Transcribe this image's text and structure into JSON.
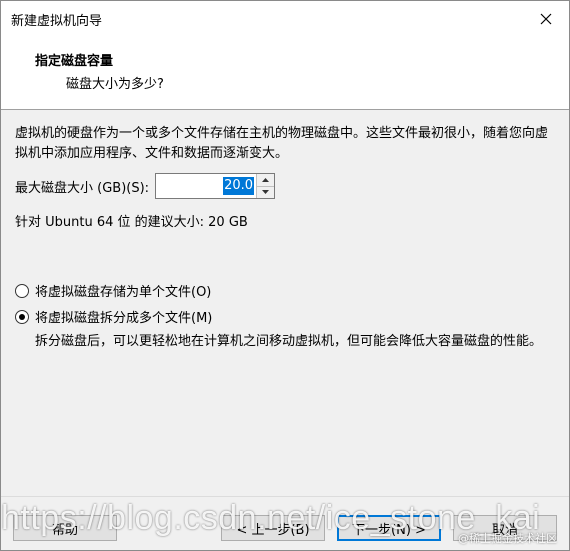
{
  "window": {
    "title": "新建虚拟机向导"
  },
  "header": {
    "title": "指定磁盘容量",
    "subtitle": "磁盘大小为多少?"
  },
  "body": {
    "description": "虚拟机的硬盘作为一个或多个文件存储在主机的物理磁盘中。这些文件最初很小，随着您向虚拟机中添加应用程序、文件和数据而逐渐变大。",
    "max_size_label": "最大磁盘大小 (GB)(S):",
    "max_size_value": "20.0",
    "recommended": "针对 Ubuntu 64 位 的建议大小: 20 GB",
    "options": [
      {
        "label": "将虚拟磁盘存储为单个文件(O)",
        "checked": false
      },
      {
        "label": "将虚拟磁盘拆分成多个文件(M)",
        "checked": true
      }
    ],
    "split_description": "拆分磁盘后，可以更轻松地在计算机之间移动虚拟机，但可能会降低大容量磁盘的性能。"
  },
  "footer": {
    "help": "帮助",
    "back": "< 上一步(B)",
    "next": "下一步(N) >",
    "cancel": "取消"
  },
  "watermark": {
    "url": "https://blog.csdn.net/ice_stone_kai",
    "credit": "@稀土掘金技术社区"
  },
  "icons": {
    "close": "close-icon",
    "spin_up": "triangle-up-icon",
    "spin_down": "triangle-down-icon"
  },
  "colors": {
    "selection": "#0078d7",
    "body_bg": "#f0f0f0",
    "header_bg": "#ffffff"
  }
}
